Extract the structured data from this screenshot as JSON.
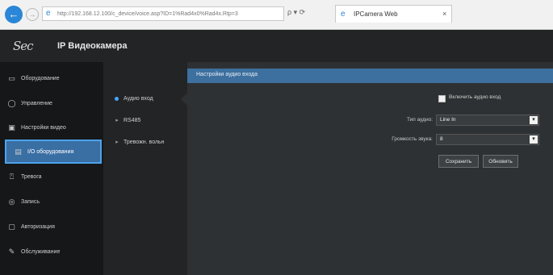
{
  "browser": {
    "address": "http://192.168.12.100/c_device/voice.asp?ID=1%Rad4x0%Rad4x.Rtp=3",
    "address_tools": "ρ ▾ ⟳",
    "tab_title": "IPCamera Web",
    "tab_close": "×",
    "back_icon": "←",
    "forward_icon": "→",
    "ie_icon": "e"
  },
  "header": {
    "logo": "Sec",
    "title": "IP Видеокамера"
  },
  "sidebar": {
    "items": [
      {
        "label": "Оборудование",
        "icon": "▭"
      },
      {
        "label": "Управление",
        "icon": "◯"
      },
      {
        "label": "Настройки видео",
        "icon": "▣"
      },
      {
        "label": "I/O оборудования",
        "icon": "▤"
      },
      {
        "label": "Тревога",
        "icon": "⍞"
      },
      {
        "label": "Запись",
        "icon": "◎"
      },
      {
        "label": "Авторизация",
        "icon": "▢"
      },
      {
        "label": "Обслуживание",
        "icon": "✎"
      }
    ],
    "active_index": 3
  },
  "subnav": {
    "items": [
      {
        "label": "Аудио вход",
        "bullet": "●"
      },
      {
        "label": "RS485",
        "bullet": "▸"
      },
      {
        "label": "Тревожн. вольн",
        "bullet": "▸"
      }
    ]
  },
  "content": {
    "title": "Настройки аудио входа",
    "enable_label": "Включить аудио вход",
    "audio_type_label": "Тип аудио:",
    "audio_type_value": "Line In",
    "volume_label": "Громкость звука:",
    "volume_value": "8",
    "select_arrow": "▾",
    "save_button": "Сохранить",
    "refresh_button": "Обновить"
  },
  "colors": {
    "accent": "#3d6f9f",
    "active_border": "#4ea3ea",
    "sidebar_bg": "#161718",
    "content_bg": "#2e3133"
  }
}
